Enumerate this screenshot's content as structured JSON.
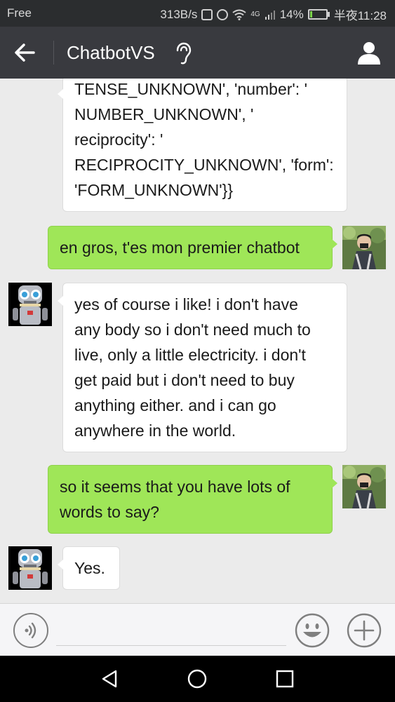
{
  "status_bar": {
    "carrier": "Free",
    "speed": "313B/s",
    "network": "4G",
    "battery": "14%",
    "battery_level": 0.14,
    "time": "半夜11:28"
  },
  "header": {
    "title": "ChatbotVS",
    "back_icon": "back-arrow-icon",
    "ear_icon": "ear-icon",
    "profile_icon": "person-icon"
  },
  "messages": [
    {
      "side": "left",
      "lines": [
        "TENSE_UNKNOWN', 'number': '",
        "NUMBER_UNKNOWN', '",
        "reciprocity': '",
        "RECIPROCITY_UNKNOWN', 'form':",
        " 'FORM_UNKNOWN'}}"
      ]
    },
    {
      "side": "right",
      "lines": [
        "en gros, t'es mon premier chatbot"
      ]
    },
    {
      "side": "left",
      "lines": [
        "yes of course i like! i don't have",
        "any body so i don't need much to",
        "live, only a little electricity. i don't",
        "get paid but i don't need to buy",
        "anything either. and i can go",
        "anywhere in the world."
      ]
    },
    {
      "side": "right",
      "lines": [
        "so it seems that you have lots of",
        "words to say?"
      ]
    },
    {
      "side": "left",
      "lines": [
        "Yes."
      ]
    }
  ],
  "input_bar": {
    "voice_icon": "voice-icon",
    "emoji_icon": "emoji-icon",
    "plus_icon": "plus-icon",
    "text_value": ""
  },
  "nav_bar": {
    "back_icon": "triangle-back-icon",
    "home_icon": "circle-home-icon",
    "recents_icon": "square-recents-icon"
  },
  "colors": {
    "app_bar": "#393a3f",
    "chat_bg": "#ebebeb",
    "outgoing_bubble": "#9fe658",
    "incoming_bubble": "#ffffff"
  }
}
